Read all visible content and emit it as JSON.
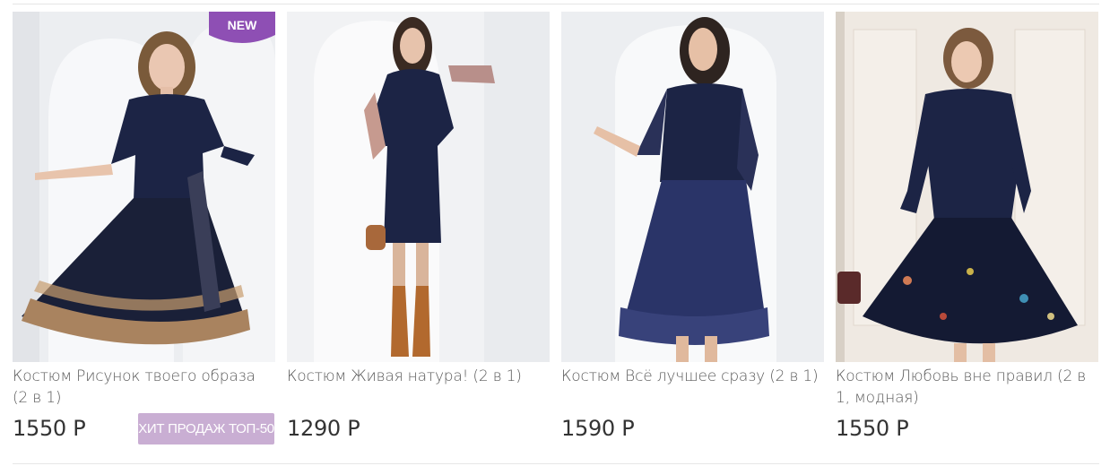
{
  "colors": {
    "badge_new": "#8e4fb4",
    "badge_hit": "#c9aed3",
    "dress_navy": "#1c2445",
    "price_text": "#333333"
  },
  "products": [
    {
      "title": "Костюм Рисунок твоего образа (2 в 1)",
      "price": "1550 Р",
      "badge_new": "NEW",
      "badge_hit": "ХИТ ПРОДАЖ ТОП-50"
    },
    {
      "title": "Костюм Живая натура! (2 в 1)",
      "price": "1290 Р"
    },
    {
      "title": "Костюм Всё лучшее сразу (2 в 1)",
      "price": "1590 Р"
    },
    {
      "title": "Костюм Любовь вне правил (2 в 1, модная)",
      "price": "1550 Р"
    }
  ]
}
